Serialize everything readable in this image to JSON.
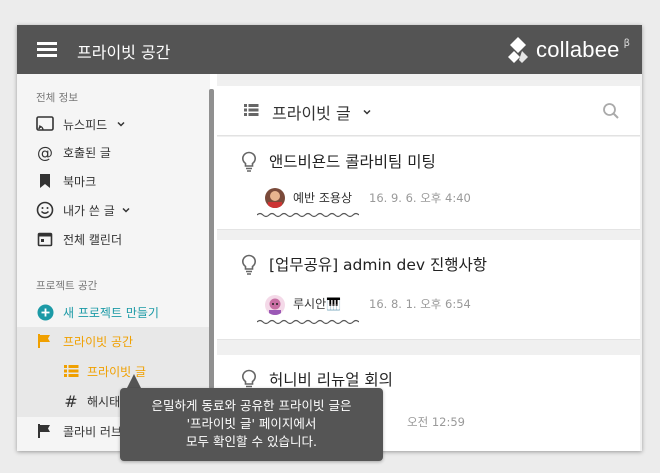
{
  "header": {
    "title": "프라이빗 공간",
    "logo_text": "collabee",
    "logo_beta": "β",
    "bg_color": "#545454"
  },
  "sidebar": {
    "section_all": "전체 정보",
    "items": [
      {
        "label": "뉴스피드",
        "icon": "feed-icon"
      },
      {
        "label": "호출된 글",
        "icon": "at-icon"
      },
      {
        "label": "북마크",
        "icon": "bookmark-icon"
      },
      {
        "label": "내가 쓴 글",
        "icon": "smiley-icon"
      },
      {
        "label": "전체 캘린더",
        "icon": "calendar-icon"
      }
    ],
    "section_projects": "프로젝트 공간",
    "create_label": "새 프로젝트 만들기",
    "private_label": "프라이빗 공간",
    "sub_private_posts": "프라이빗 글",
    "sub_hashtag": "해시태그",
    "other_project": "콜라비 러브",
    "accent_color": "#f0a000",
    "create_color": "#1c9aa6"
  },
  "main": {
    "title": "프라이빗 글",
    "posts": [
      {
        "title": "앤드비욘드 콜라비팀 미팅",
        "author": "예반 조용상",
        "time": "16. 9. 6. 오후 4:40"
      },
      {
        "title": "[업무공유] admin dev 진행사항",
        "author": "루시안🎹",
        "time": "16. 8. 1. 오후 6:54"
      },
      {
        "title": "허니비 리뉴얼 회의",
        "author": "",
        "time": "오전 12:59"
      }
    ]
  },
  "tooltip": {
    "line1": "은밀하게 동료와 공유한 프라이빗 글은",
    "line2": "'프라이빗 글' 페이지에서",
    "line3": "모두 확인할 수 있습니다."
  }
}
